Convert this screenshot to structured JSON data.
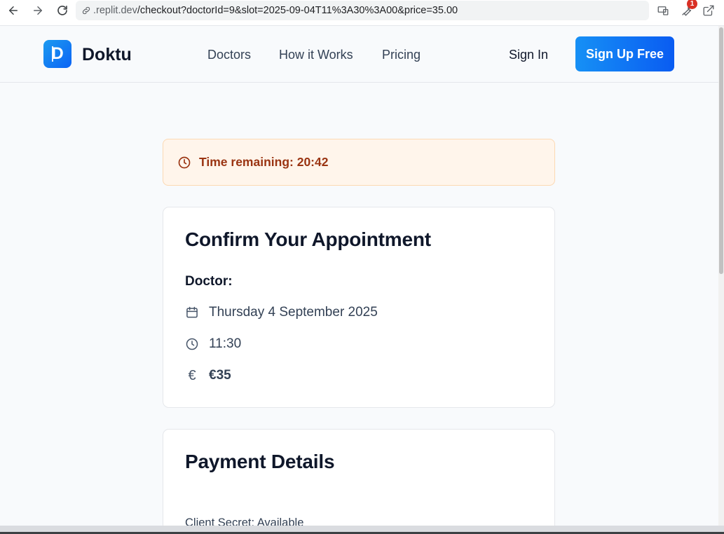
{
  "browser": {
    "url_host": ".replit.dev",
    "url_path": "/checkout?doctorId=9&slot=2025-09-04T11%3A30%3A00&price=35.00",
    "extension_badge": "1"
  },
  "header": {
    "logo_letter": "D",
    "brand": "Doktu",
    "nav": [
      "Doctors",
      "How it Works",
      "Pricing"
    ],
    "sign_in": "Sign In",
    "sign_up": "Sign Up Free"
  },
  "timer": {
    "text": "Time remaining: 20:42"
  },
  "confirm": {
    "title": "Confirm Your Appointment",
    "doctor_label": "Doctor:",
    "date": "Thursday 4 September 2025",
    "time": "11:30",
    "price": "€35",
    "currency_symbol": "€"
  },
  "payment": {
    "title": "Payment Details",
    "client_secret": "Client Secret: Available"
  },
  "colors": {
    "primary": "#0a63f5",
    "warning_bg": "#fff5eb",
    "warning_text": "#9a3412"
  }
}
